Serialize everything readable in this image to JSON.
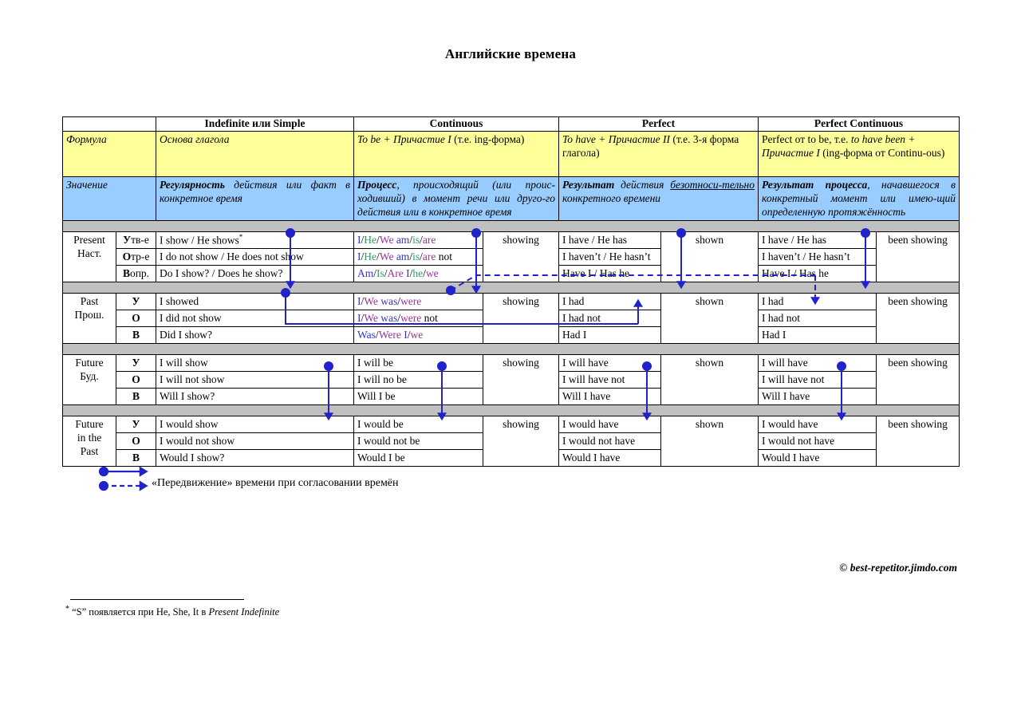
{
  "title": "Английские времена",
  "colors": {
    "formula_bg": "#ffff99",
    "meaning_bg": "#99ccff",
    "spacer_bg": "#c0c0c0",
    "arrow": "#2222cc",
    "person_blue": "#3333cc",
    "person_green": "#339966",
    "person_purple": "#993399"
  },
  "header": {
    "corner": "",
    "columns": [
      "Indefinite или Simple",
      "Continuous",
      "Perfect",
      "Perfect Continuous"
    ]
  },
  "rows": {
    "formula": {
      "label": "Формула",
      "indefinite": "Основа глагола",
      "continuous_it": "To be",
      "continuous_rest": " + Причастие I",
      "continuous_tail": " (т.е. ing-форма)",
      "perfect_it": "To have  +  Причастие II",
      "perfect_tail": " (т.е. 3-я форма глагола)",
      "perfect_cont_a": "Perfect от to be, т.е. ",
      "perfect_cont_it": "to have been + Причастие I",
      "perfect_cont_b": " (ing-форма от Continu-ous)"
    },
    "meaning": {
      "label": "Значение",
      "indefinite_b": "Регулярность",
      "indefinite_rest": " действия или факт в конкретное время",
      "continuous_b": "Процесс",
      "continuous_rest": ", происходящий (или проис-ходивший) в момент речи или друго-го действия или в конкретное время",
      "perfect_b": "Результат",
      "perfect_mid": " действия ",
      "perfect_u": "безотноси-тельно",
      "perfect_rest": " конкретного времени",
      "perfect_cont_b": "Результат процесса",
      "perfect_cont_rest": ", начавшегося в конкретный момент или имею-щий определенную протяжённость"
    }
  },
  "tenses": [
    {
      "name_line1": "Present",
      "name_line2": "Наст.",
      "forms": [
        "Утв-е",
        "Отр-е",
        "Вопр."
      ],
      "indefinite": [
        "I show / He shows",
        "I do not show / He does not show",
        "Do I show? / Does he show?"
      ],
      "indefinite_footnote_mark": "*",
      "continuous_colored": [
        [
          [
            "I",
            "blue"
          ],
          [
            "/",
            "black"
          ],
          [
            "He",
            "green"
          ],
          [
            "/",
            "black"
          ],
          [
            "We",
            "purple"
          ],
          [
            " ",
            "black"
          ],
          [
            "am",
            "blue"
          ],
          [
            "/",
            "black"
          ],
          [
            "is",
            "green"
          ],
          [
            "/",
            "black"
          ],
          [
            "are",
            "purple"
          ]
        ],
        [
          [
            "I",
            "blue"
          ],
          [
            "/",
            "black"
          ],
          [
            "He",
            "green"
          ],
          [
            "/",
            "black"
          ],
          [
            "We",
            "purple"
          ],
          [
            " ",
            "black"
          ],
          [
            "am",
            "blue"
          ],
          [
            "/",
            "black"
          ],
          [
            "is",
            "green"
          ],
          [
            "/",
            "black"
          ],
          [
            "are",
            "purple"
          ],
          [
            " not",
            "black"
          ]
        ],
        [
          [
            "Am",
            "blue"
          ],
          [
            "/",
            "black"
          ],
          [
            "Is",
            "green"
          ],
          [
            "/",
            "black"
          ],
          [
            "Are",
            "purple"
          ],
          [
            " ",
            "black"
          ],
          [
            "I",
            "blue"
          ],
          [
            "/",
            "black"
          ],
          [
            "he",
            "green"
          ],
          [
            "/",
            "black"
          ],
          [
            "we",
            "purple"
          ]
        ]
      ],
      "continuous_tail": "showing",
      "perfect": [
        "I have / He has",
        "I haven’t / He hasn’t",
        "Have I / Has he"
      ],
      "perfect_tail": "shown",
      "perfect_cont": [
        "I have / He has",
        "I haven’t / He hasn’t",
        "Have I / Has he"
      ],
      "perfect_cont_tail": "been showing"
    },
    {
      "name_line1": "Past",
      "name_line2": "Прош.",
      "forms": [
        "У",
        "О",
        "В"
      ],
      "indefinite": [
        "I showed",
        "I did not show",
        "Did I show?"
      ],
      "continuous_colored": [
        [
          [
            "I",
            "blue"
          ],
          [
            "/",
            "black"
          ],
          [
            "We",
            "purple"
          ],
          [
            " ",
            "black"
          ],
          [
            "was",
            "blue"
          ],
          [
            "/",
            "black"
          ],
          [
            "were",
            "purple"
          ]
        ],
        [
          [
            "I",
            "blue"
          ],
          [
            "/",
            "black"
          ],
          [
            "We",
            "purple"
          ],
          [
            " ",
            "black"
          ],
          [
            "was",
            "blue"
          ],
          [
            "/",
            "black"
          ],
          [
            "were",
            "purple"
          ],
          [
            " not",
            "black"
          ]
        ],
        [
          [
            "Was",
            "blue"
          ],
          [
            "/",
            "black"
          ],
          [
            "Were",
            "purple"
          ],
          [
            " ",
            "black"
          ],
          [
            "I",
            "blue"
          ],
          [
            "/",
            "black"
          ],
          [
            "we",
            "purple"
          ]
        ]
      ],
      "continuous_tail": "showing",
      "perfect": [
        "I had",
        "I had not",
        "Had I"
      ],
      "perfect_tail": "shown",
      "perfect_cont": [
        "I had",
        "I had not",
        "Had I"
      ],
      "perfect_cont_tail": "been showing"
    },
    {
      "name_line1": "Future",
      "name_line2": "Буд.",
      "forms": [
        "У",
        "О",
        "В"
      ],
      "indefinite": [
        "I will show",
        "I will not show",
        "Will I show?"
      ],
      "continuous_plain": [
        "I will be",
        "I will no be",
        "Will I be"
      ],
      "continuous_tail": "showing",
      "perfect": [
        "I will have",
        "I will have not",
        "Will I have"
      ],
      "perfect_tail": "shown",
      "perfect_cont": [
        "I will have",
        "I will have not",
        "Will I have"
      ],
      "perfect_cont_tail": "been showing"
    },
    {
      "name_line1": "Future",
      "name_line2": "in the",
      "name_line3": "Past",
      "forms": [
        "У",
        "О",
        "В"
      ],
      "indefinite": [
        "I would show",
        "I would not show",
        "Would I show?"
      ],
      "continuous_plain": [
        "I would be",
        "I would not be",
        "Would I be"
      ],
      "continuous_tail": "showing",
      "perfect": [
        "I would have",
        "I would not have",
        "Would I have"
      ],
      "perfect_tail": "shown",
      "perfect_cont": [
        "I would have",
        "I would not have",
        "Would I have"
      ],
      "perfect_cont_tail": "been showing"
    }
  ],
  "legend": {
    "text": "«Передвижение» времени при согласовании времён"
  },
  "copyright": "© best-repetitor.jimdo.com",
  "footnote": {
    "mark": "*",
    "text_a": " “S”  появляется при He, She, It в ",
    "text_italic": "Present Indefinite"
  }
}
